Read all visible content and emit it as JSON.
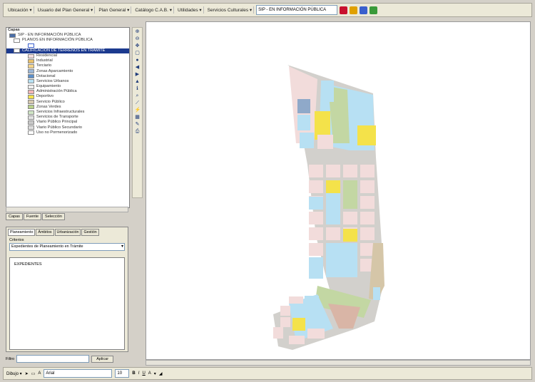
{
  "toolbar": {
    "items": [
      "Ubicación ▾",
      "Usuario del Plan General ▾",
      "Plan General ▾",
      "Catálogo C.A.B. ▾",
      "Utilidades ▾",
      "Servicios Culturales ▾"
    ],
    "combo_value": "SIP - EN INFORMACIÓN PÚBLICA",
    "button_colors": [
      "#c8102e",
      "#e0a000",
      "#3a5fcd",
      "#3a9a3a"
    ]
  },
  "toc": {
    "header": "Capas",
    "root": "SIP - EN INFORMACIÓN PÚBLICA",
    "group": "PLANOS EN INFORMACIÓN PÚBLICA",
    "selected_layer": "CALIFICACIÓN DE TERRENOS EN TRAMITE",
    "legend": [
      {
        "label": "Residencial",
        "color": "#f2dcdb"
      },
      {
        "label": "Industrial",
        "color": "#e8c06a"
      },
      {
        "label": "Terciario",
        "color": "#f6d58a"
      },
      {
        "label": "Zonas Aparcamiento",
        "color": "#9bb6d6"
      },
      {
        "label": "Dotacional",
        "color": "#5b8fc9"
      },
      {
        "label": "Servicios Urbanos",
        "color": "#b7e0f3"
      },
      {
        "label": "Equipamiento",
        "color": "#eeeeee"
      },
      {
        "label": "Administración Pública",
        "color": "#f2b6b6"
      },
      {
        "label": "Deportivo",
        "color": "#f4e24a"
      },
      {
        "label": "Servicio Público",
        "color": "#d7c9ae"
      },
      {
        "label": "Zonas Verdes",
        "color": "#b9d18a"
      },
      {
        "label": "Servicios Infraestructurales",
        "color": "#cfe4c4"
      },
      {
        "label": "Servicios de Transporte",
        "color": "#e2e2e2"
      },
      {
        "label": "Viario Público Principal",
        "color": "#c9c9c9"
      },
      {
        "label": "Viario Público Secundario",
        "color": "#dedede"
      },
      {
        "label": "Uso no Pormenorizado",
        "color": "#ffffff"
      }
    ]
  },
  "left_tabs": [
    "Capas",
    "Fuente",
    "Selección"
  ],
  "panel2": {
    "tabs": [
      "Planeamiento",
      "Ámbitos",
      "Urbanización",
      "Gestión"
    ],
    "label": "Criterios",
    "select_value": "Expedientes de Planeamiento en Trámite",
    "list_item": "EXPEDIENTES"
  },
  "filter": {
    "label": "Filtro",
    "button": "Aplicar"
  },
  "drawbar": {
    "draw_label": "Dibujo ▾",
    "font_value": "Arial",
    "size_value": "10",
    "bold": "B",
    "italic": "I",
    "underline": "U",
    "font_color": "A"
  },
  "map": {
    "colors": {
      "residential": "#f2dcdb",
      "green": "#c3d7a3",
      "lightblue": "#b7e0f3",
      "yellow": "#f4e24a",
      "road": "#d2d0cc",
      "brown": "#d9b5a6",
      "tan": "#d5c6a8",
      "steel": "#8fa9c9"
    }
  }
}
